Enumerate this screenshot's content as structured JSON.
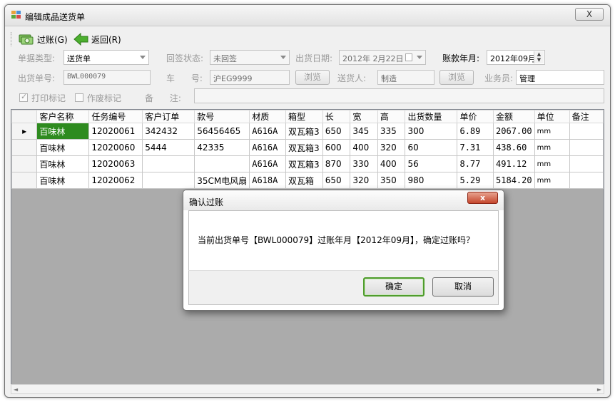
{
  "window": {
    "title": "编辑成品送货单",
    "close_glyph": "X"
  },
  "toolbar": {
    "post_label": "过账(G)",
    "back_label": "返回(R)"
  },
  "form": {
    "doc_type_label": "单据类型:",
    "doc_type_value": "送货单",
    "sign_status_label": "回签状态:",
    "sign_status_value": "未回签",
    "ship_date_label": "出货日期:",
    "ship_date_value": "2012年  2月22日",
    "account_month_label": "账款年月:",
    "account_month_value": "2012年09月",
    "ship_no_label": "出货单号:",
    "ship_no_value": "BWL000079",
    "vehicle_label": "车      号:",
    "vehicle_value": "沪EG9999",
    "browse_label": "浏览",
    "deliverer_label": "送货人:",
    "deliverer_value": "制造",
    "salesman_label": "业务员:",
    "salesman_value": "管理",
    "print_flag_label": "打印标记",
    "void_flag_label": "作废标记",
    "remark_label": "备      注:",
    "remark_value": ""
  },
  "grid": {
    "columns": [
      "客户名称",
      "任务编号",
      "客户订单",
      "款号",
      "材质",
      "箱型",
      "长",
      "宽",
      "高",
      "出货数量",
      "单价",
      "金额",
      "单位",
      "备注"
    ],
    "rows": [
      [
        "百味林",
        "12020061",
        "342432",
        "56456465",
        "A616A",
        "双瓦箱3",
        "650",
        "345",
        "335",
        "300",
        "6.89",
        "2067.00",
        "mm",
        ""
      ],
      [
        "百味林",
        "12020060",
        "5444",
        "42335",
        "A616A",
        "双瓦箱3",
        "600",
        "400",
        "320",
        "60",
        "7.31",
        "438.60",
        "mm",
        ""
      ],
      [
        "百味林",
        "12020063",
        "",
        "",
        "A616A",
        "双瓦箱3",
        "870",
        "330",
        "400",
        "56",
        "8.77",
        "491.12",
        "mm",
        ""
      ],
      [
        "百味林",
        "12020062",
        "",
        "35CM电风扇",
        "A618A",
        "双瓦箱",
        "650",
        "320",
        "350",
        "980",
        "5.29",
        "5184.20",
        "mm",
        ""
      ]
    ]
  },
  "dialog": {
    "title": "确认过账",
    "message": "当前出货单号【BWL000079】过账年月【2012年09月】，确定过账吗？",
    "ok_label": "确定",
    "cancel_label": "取消",
    "close_glyph": "x"
  },
  "colors": {
    "selected_cell": "#2e8b1f",
    "accent_green": "#4f9d2c",
    "close_red": "#c5462c"
  }
}
